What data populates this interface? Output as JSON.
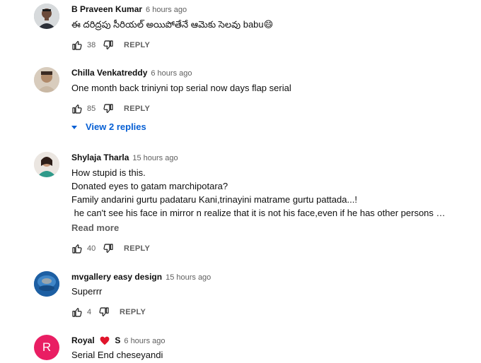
{
  "comments": [
    {
      "author": "B Praveen Kumar",
      "time": "6 hours ago",
      "text": "ఈ దరిద్రపు సీరియల్ అయిపోతేనే ఆమెకు సెలవు babu",
      "emoji": "😄",
      "likes": "38",
      "reply_label": "REPLY"
    },
    {
      "author": "Chilla Venkatreddy",
      "time": "6 hours ago",
      "text": "One month back triniyni top serial now days flap serial",
      "likes": "85",
      "reply_label": "REPLY",
      "view_replies": "View 2 replies"
    },
    {
      "author": "Shylaja Tharla",
      "time": "15 hours ago",
      "lines": [
        "How stupid is this.",
        "Donated eyes to gatam marchipotara?",
        "Family andarini gurtu padataru Kani,trinayini matrame gurtu pattada...!",
        " he can't see his face in mirror n realize that it is not his face,even if he has other persons …"
      ],
      "read_more": "Read more",
      "likes": "40",
      "reply_label": "REPLY"
    },
    {
      "author": "mvgallery easy design",
      "time": "15 hours ago",
      "text": "Superrr",
      "likes": "4",
      "reply_label": "REPLY"
    },
    {
      "author_first": "Royal",
      "author_last": "S",
      "time": "6 hours ago",
      "text": "Serial End cheseyandi",
      "avatar_letter": "R",
      "avatar_color": "#e91e63"
    }
  ],
  "colors": {
    "link": "#065fd4",
    "meta": "#606060",
    "heart": "#e0142b"
  }
}
